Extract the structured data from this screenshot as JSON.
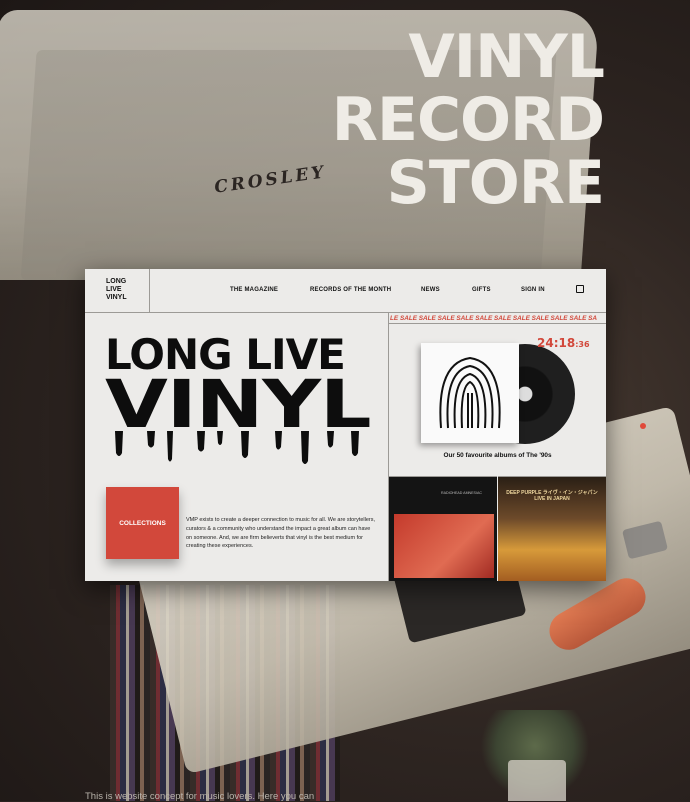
{
  "hero": {
    "line1": "VINYL",
    "line2": "RECORD",
    "line3": "STORE"
  },
  "photo": {
    "turntable_brand": "CROSLEY"
  },
  "site": {
    "logo": {
      "line1": "LONG",
      "line2": "LIVE",
      "line3": "VINYL"
    },
    "nav": {
      "items": [
        "THE MAGAZINE",
        "RECORDS OF THE MONTH",
        "NEWS",
        "GIFTS",
        "SIGN IN"
      ],
      "cart_icon": "shopping-bag-icon"
    },
    "headline": {
      "line1": "LONG LIVE",
      "line2": "VINYL"
    },
    "collections_label": "COLLECTIONS",
    "about_text": "VMP exists to create a deeper connection to music for all. We are storytellers, curators & a community who understand the impact a great album can have on someone. And, we are firm believerts that vinyl is the best medium for creating these experiences.",
    "ticker": "LE SALE SALE SALE SALE SALE SALE SALE SALE SALE SALE SA",
    "feature": {
      "countdown_main": "24:18",
      "countdown_seconds": ":36",
      "caption": "Our 50 favourite albums of The '90s"
    },
    "albums": [
      {
        "label": "RADIOHEAD AMNESIAC"
      },
      {
        "label": "DEEP PURPLE ライヴ・イン・ジャパン LIVE IN JAPAN"
      }
    ]
  },
  "intro_text": "This is website concept for music lovers. Here you can",
  "colors": {
    "accent": "#d2483b",
    "site_bg": "#ecebe9",
    "hero_text": "#efece6"
  }
}
